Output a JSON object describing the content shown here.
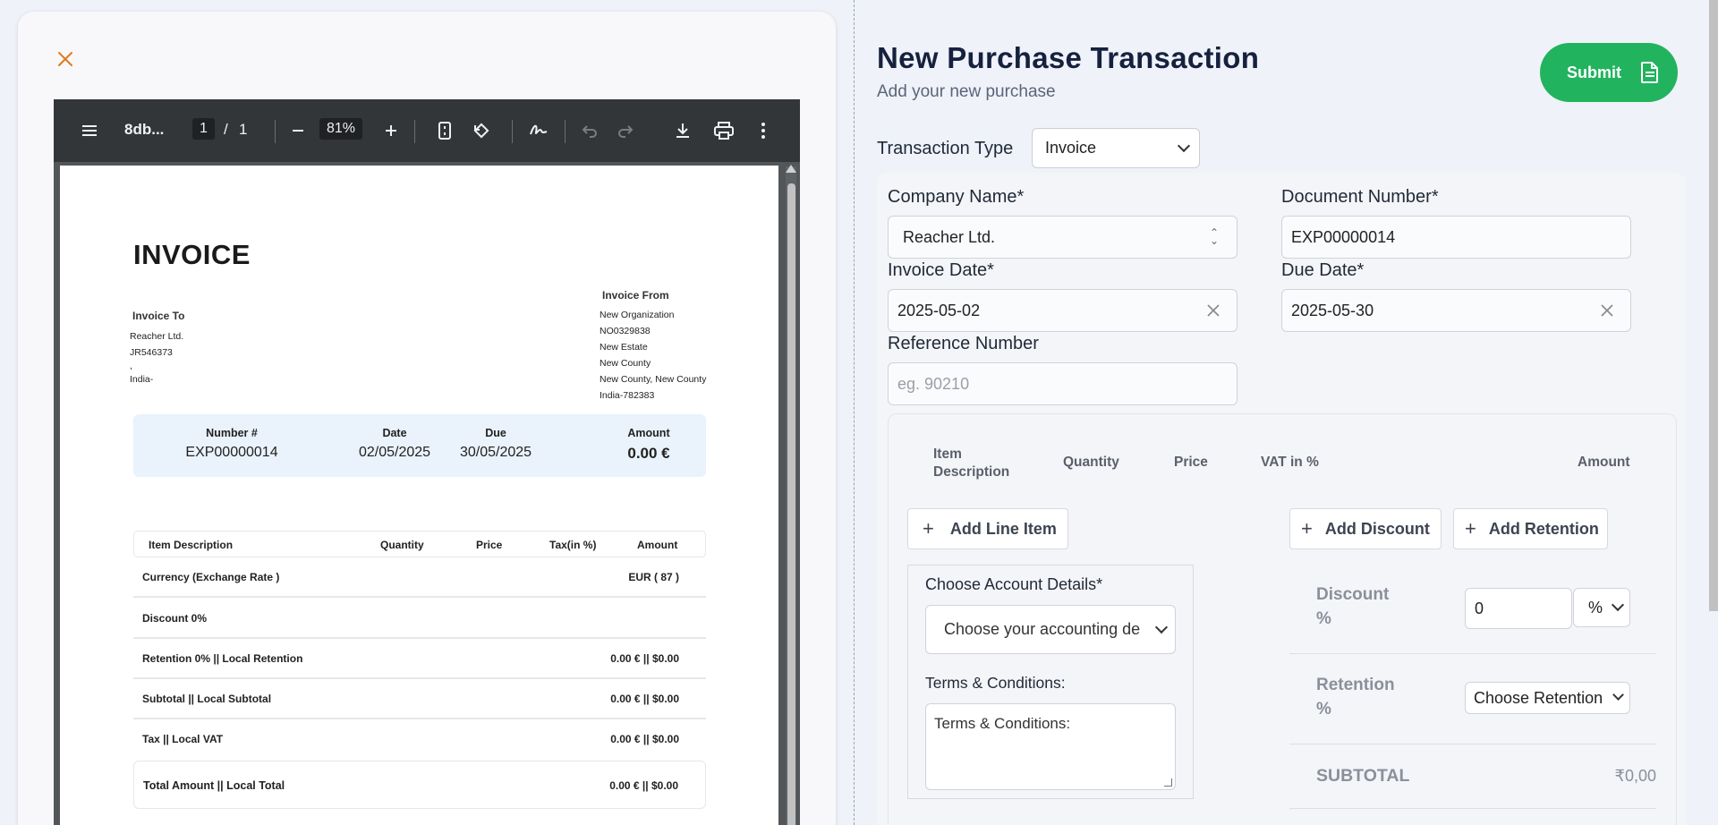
{
  "pdf": {
    "close_label": "×",
    "toolbar": {
      "filename": "8db...",
      "page_current": "1",
      "page_sep": "/",
      "page_total": "1",
      "zoom": "81%"
    },
    "invoice": {
      "title": "INVOICE",
      "to_label": "Invoice To",
      "to_lines": [
        "Reacher Ltd.",
        "JR546373",
        ",",
        "India-"
      ],
      "from_label": "Invoice From",
      "from_lines": [
        "New Organization",
        "NO0329838",
        "New Estate",
        "New County",
        "New County, New County",
        "India-782383"
      ],
      "summary": {
        "number_label": "Number #",
        "number": "EXP00000014",
        "date_label": "Date",
        "date": "02/05/2025",
        "due_label": "Due",
        "due": "30/05/2025",
        "amount_label": "Amount",
        "amount": "0.00 €"
      },
      "table_headers": [
        "Item Description",
        "Quantity",
        "Price",
        "Tax(in %)",
        "Amount"
      ],
      "rows": [
        {
          "label": "Currency (Exchange Rate )",
          "value": "EUR ( 87 )"
        },
        {
          "label": "Discount 0%",
          "value": ""
        },
        {
          "label": "Retention 0% || Local Retention",
          "value": "0.00 € || $0.00"
        },
        {
          "label": "Subtotal || Local Subtotal",
          "value": "0.00 € || $0.00"
        },
        {
          "label": "Tax || Local VAT",
          "value": "0.00 € || $0.00"
        }
      ],
      "total": {
        "label": "Total Amount || Local Total",
        "value": "0.00 € || $0.00"
      }
    }
  },
  "form": {
    "title": "New Purchase Transaction",
    "subtitle": "Add your new purchase",
    "submit_label": "Submit",
    "transaction_type_label": "Transaction Type",
    "transaction_type_value": "Invoice",
    "company_name_label": "Company Name*",
    "company_name_value": "Reacher Ltd.",
    "document_number_label": "Document Number*",
    "document_number_value": "EXP00000014",
    "invoice_date_label": "Invoice Date*",
    "invoice_date_value": "2025-05-02",
    "due_date_label": "Due Date*",
    "due_date_value": "2025-05-30",
    "reference_label": "Reference Number",
    "reference_placeholder": "eg. 90210",
    "items": {
      "headers": {
        "description": "Item\nDescription",
        "quantity": "Quantity",
        "price": "Price",
        "vat": "VAT in %",
        "amount": "Amount"
      },
      "add_line_item": "Add Line Item",
      "add_discount": "Add Discount",
      "add_retention": "Add Retention",
      "account_label": "Choose Account Details*",
      "account_placeholder": "Choose your accounting de",
      "terms_label": "Terms & Conditions:",
      "terms_placeholder": "Terms & Conditions:",
      "discount_label_1": "Discount",
      "discount_label_2": "%",
      "discount_value": "0",
      "discount_unit": "%",
      "retention_label_1": "Retention",
      "retention_label_2": "%",
      "retention_placeholder": "Choose Retention",
      "subtotal_label": "SUBTOTAL",
      "subtotal_value": "₹0,00"
    }
  },
  "colors": {
    "accent_green": "#22b35e",
    "close_orange": "#e07a1f",
    "toolbar_dark": "#323639"
  }
}
